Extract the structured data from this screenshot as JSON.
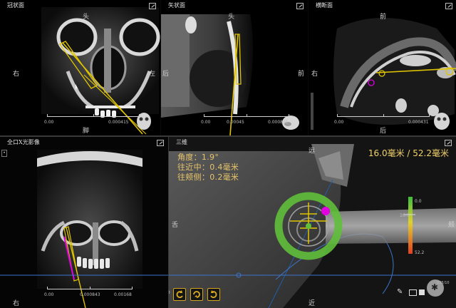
{
  "panes": {
    "coronal": {
      "title": "冠状面",
      "top": "头",
      "bottom": "脚",
      "left": "右",
      "right": "左",
      "scale_start": "0.00",
      "scale_end": "0.000415"
    },
    "sagittal": {
      "title": "矢状面",
      "top": "头",
      "bottom": "",
      "left": "后",
      "right": "前",
      "scale_start": "0.00",
      "scale_mid": "0.00045",
      "scale_end": "0.000835"
    },
    "axial": {
      "title": "横断面",
      "top": "前",
      "bottom": "后",
      "left": "右",
      "right": "",
      "scale_start": "0.00",
      "scale_end": "0.000431"
    },
    "panoramic": {
      "title": "全口X光影像",
      "left_label": "右",
      "scale_start": "0.00",
      "scale_mid": "0.000843",
      "scale_end": "0.00168"
    },
    "three_d": {
      "title": "三维",
      "top": "远",
      "left": "舌",
      "right": "颊",
      "bottom": "近"
    }
  },
  "measurements": [
    {
      "label": "角度",
      "value": "1.9°"
    },
    {
      "label": "往近中",
      "value": "0.4毫米"
    },
    {
      "label": "往颊侧",
      "value": "0.2毫米"
    }
  ],
  "distance_readout": "16.0毫米 / 52.2毫米",
  "depth_bar": {
    "top_label": "0.0",
    "mid_label": "16.0",
    "bottom_label": "52.2",
    "fraction": 0.31
  },
  "toolbar": {
    "buttons": [
      "rotate-left-icon",
      "rotate-3d-icon",
      "rotate-right-icon"
    ],
    "right_icons": [
      "pencil-icon",
      "screen-icon",
      "layers-icon",
      "settings-icon"
    ],
    "thumb_value": "035/10"
  },
  "colors": {
    "implant": "#e0c400",
    "guide_ring": "#5fbf3a",
    "marker": "#e000e0"
  }
}
